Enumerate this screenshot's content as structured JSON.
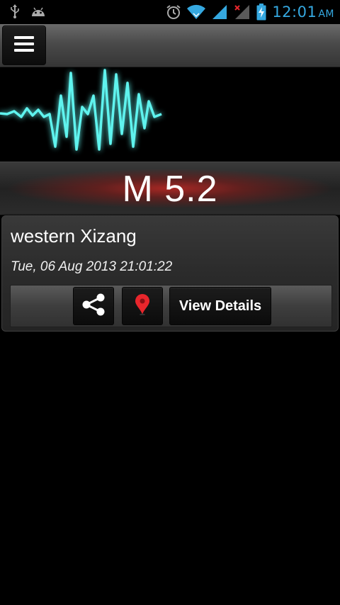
{
  "status_bar": {
    "time": "12:01",
    "ampm": "AM",
    "icons": [
      "usb-icon",
      "android-debug-icon",
      "alarm-icon",
      "wifi-icon",
      "signal-icon",
      "signal-no-data-icon",
      "battery-charging-icon"
    ]
  },
  "action_bar": {
    "menu_icon": "hamburger-menu-icon"
  },
  "waveform": {
    "color": "#5ff3ee"
  },
  "quake": {
    "magnitude": "M 5.2",
    "location": "western Xizang",
    "datetime": "Tue, 06 Aug 2013 21:01:22"
  },
  "actions": {
    "share_icon": "share-icon",
    "map_icon": "map-pin-icon",
    "details_label": "View Details"
  },
  "colors": {
    "accent_blue": "#35a8e0",
    "pin_red": "#e8262c",
    "band_red": "#b02824"
  }
}
